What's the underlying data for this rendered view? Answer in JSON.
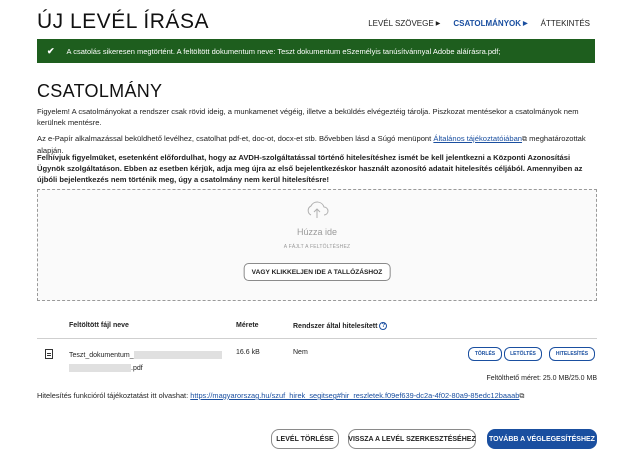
{
  "page_title": "ÚJ LEVÉL ÍRÁSA",
  "top_nav": {
    "items": [
      {
        "label": "LEVÉL SZÖVEGE"
      },
      {
        "label": "CSATOLMÁNYOK"
      },
      {
        "label": "ÁTTEKINTÉS"
      }
    ],
    "active": "CSATOLMÁNYOK"
  },
  "banner": {
    "text": "A csatolás sikeresen megtörtént. A feltöltött dokumentum neve: Teszt dokumentum eSzemélyis tanúsítvánnyal Adobe aláírásra.pdf;",
    "color": "#1e5e1e"
  },
  "section_title": "CSATOLMÁNY",
  "paragraphs": {
    "p1": "Figyelem! A csatolmányokat a rendszer csak rövid ideig, a munkamenet végéig, illetve a beküldés elvégeztéig tárolja. Piszkozat mentésekor a csatolmányok nem kerülnek mentésre.",
    "p2_before": "Az e-Papír alkalmazással beküldhető levélhez, csatolhat pdf-et, doc-ot, docx-et stb. Bővebben lásd a Súgó menüpont ",
    "p2_link": "Általános tájékoztatóiában",
    "p2_after": " meghatározottak alapján.",
    "p3": "Felhívjuk figyelmüket, esetenként előfordulhat, hogy az AVDH-szolgáltatással történő hitelesítéshez ismét be kell jelentkezni a Központi Azonosítási Ügynök szolgáltatáson. Ebben az esetben kérjük, adja meg újra az első bejelentkezéskor használt azonosító adatait hitelesítés céljából. Amennyiben az újbóli bejelentkezés nem történik meg, úgy a csatolmány nem kerül hitelesítésre!"
  },
  "dropzone": {
    "title": "Húzza ide",
    "subtitle": "A FÁJLT A FELTÖLTÉSHEZ",
    "browse_label": "VAGY KLIKKELJEN IDE A TALLÓZÁSHOZ"
  },
  "table": {
    "headers": {
      "name": "Feltöltött fájl neve",
      "size": "Mérete",
      "auth": "Rendszer által hitelesített"
    },
    "rows": [
      {
        "name_line1": "Teszt_dokumentum_",
        "name_line2": ".pdf",
        "size": "16.6 kB",
        "authenticated": "Nem",
        "actions": {
          "delete": "TÖRLÉS",
          "download": "LETÖLTÉS",
          "authenticate": "HITELESÍTÉS"
        }
      }
    ],
    "upload_size": "Feltölthető méret: 25.0 MB/25.0 MB"
  },
  "auth_info": {
    "text": "Hitelesítés funkcióról tájékoztatást itt olvashat: ",
    "link": "https://magyarorszag.hu/szuf_hirek_segitseg#hir_reszletek.f09ef639-dc2a-4f02-80a9-85edc12baaab"
  },
  "footer": {
    "delete_letter": "LEVÉL TÖRLÉSE",
    "back_to_editor": "VISSZA A LEVÉL SZERKESZTÉSÉHEZ",
    "finalize": "TOVÁBB A VÉGLEGESÍTÉSHEZ"
  },
  "colors": {
    "accent": "#1a4fa0",
    "success": "#1e5e1e"
  }
}
